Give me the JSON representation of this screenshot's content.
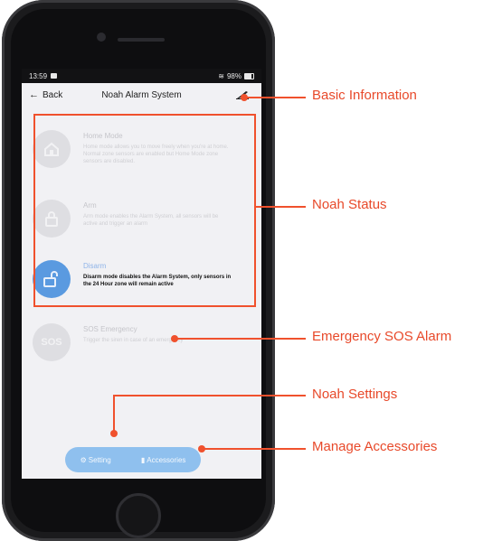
{
  "statusbar": {
    "time": "13:59",
    "signal": "98%"
  },
  "appbar": {
    "back_label": "Back",
    "title": "Noah Alarm System"
  },
  "modes": [
    {
      "title": "Home Mode",
      "description": "Home mode allows you to move freely when you're at home. Normal zone sensors are enabled but Home Mode zone sensors are disabled."
    },
    {
      "title": "Arm",
      "description": "Arm mode enables the Alarm System, all sensors will be active and trigger an alarm"
    },
    {
      "title": "Disarm",
      "description": "Disarm mode disables the Alarm System, only sensors in the 24 Hour zone will remain active"
    },
    {
      "title": "SOS Emergency",
      "description": "Trigger the siren in case of an emergency",
      "badge": "SOS"
    }
  ],
  "bottom": {
    "setting_label": "Setting",
    "accessories_label": "Accessories"
  },
  "annotations": {
    "basic_info": "Basic Information",
    "status": "Noah Status",
    "sos": "Emergency SOS Alarm",
    "settings": "Noah Settings",
    "accessories": "Manage Accessories"
  },
  "colors": {
    "accent": "#f0512d",
    "active_mode": "#5a9ae0",
    "bottom_bar": "#8fc0ee"
  }
}
